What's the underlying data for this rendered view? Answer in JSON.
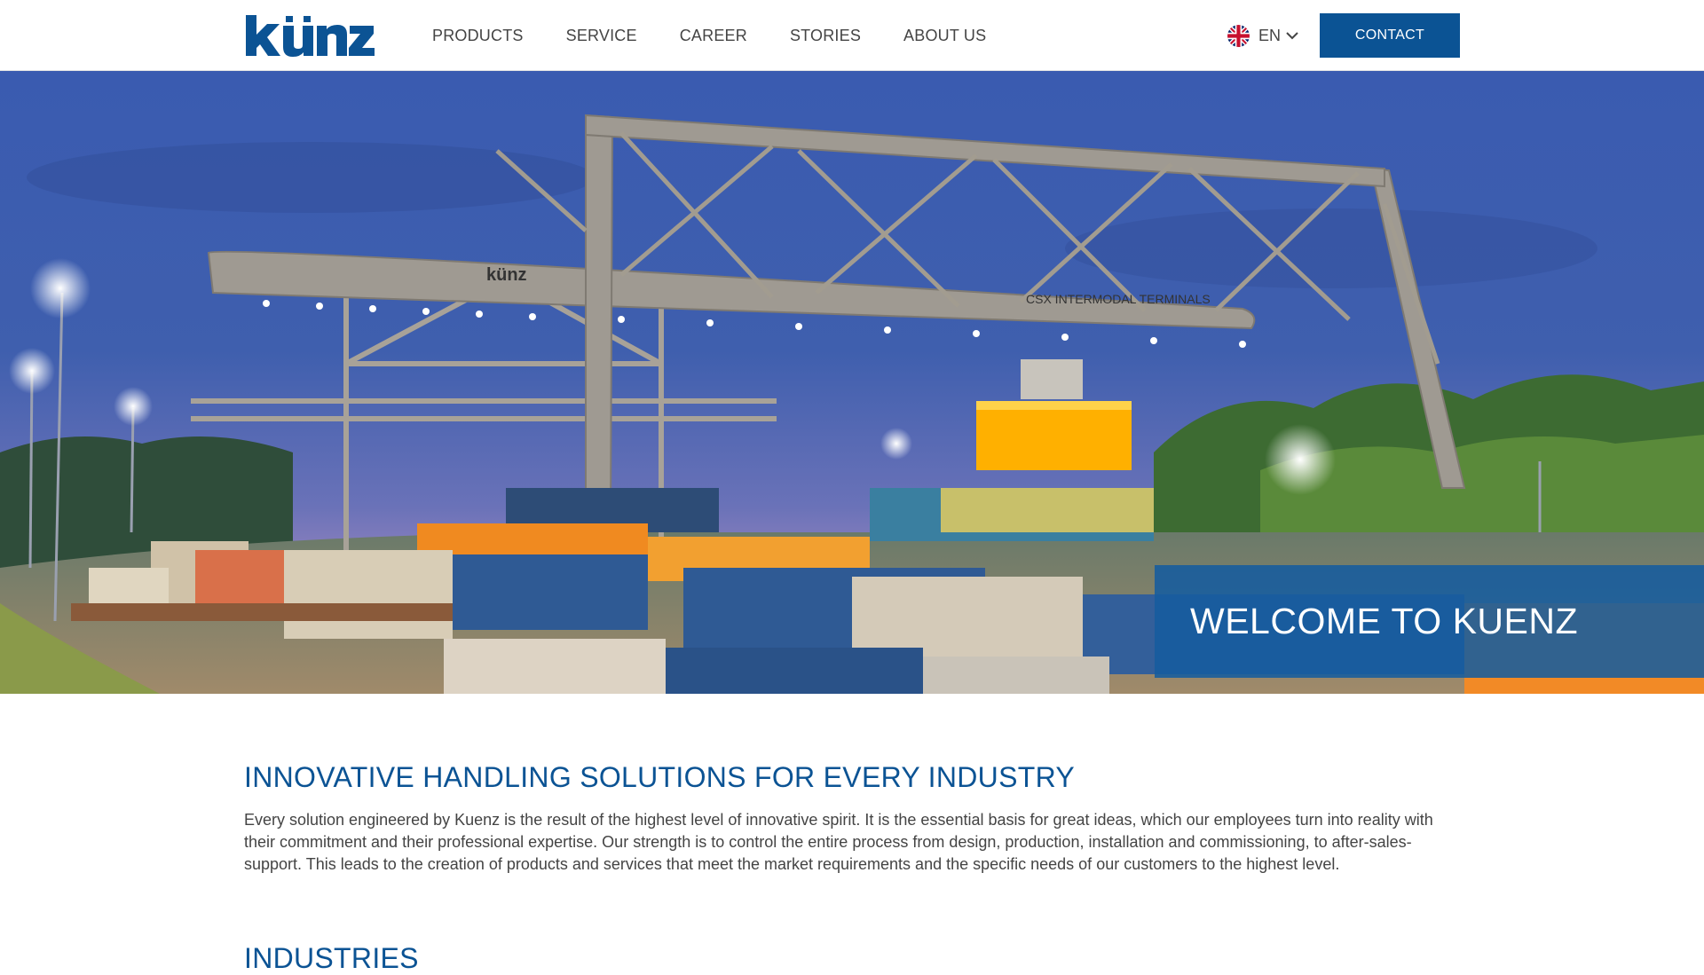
{
  "header": {
    "logo_text": "künz",
    "nav": [
      "PRODUCTS",
      "SERVICE",
      "CAREER",
      "STORIES",
      "ABOUT US"
    ],
    "language": "EN",
    "contact_label": "CONTACT"
  },
  "hero": {
    "welcome": "WELCOME TO KUENZ",
    "crane_logo_text": "künz",
    "crane_sign_text": "CSX INTERMODAL TERMINALS"
  },
  "intro": {
    "title": "INNOVATIVE HANDLING SOLUTIONS FOR EVERY INDUSTRY",
    "body": "Every solution engineered by Kuenz is the result of the highest level of innovative spirit. It is the essential basis for great ideas, which our employees turn into reality with their commitment and their professional expertise. Our strength is to control the entire process from design, production, installation and commissioning, to after-sales-support. This leads to the creation of products and services that meet the market requirements and the specific needs of our customers to the highest level."
  },
  "industries": {
    "title": "INDUSTRIES"
  },
  "colors": {
    "brand_blue": "#0b5394",
    "overlay_blue": "#165c9e",
    "sky": "#3f5fb0"
  }
}
